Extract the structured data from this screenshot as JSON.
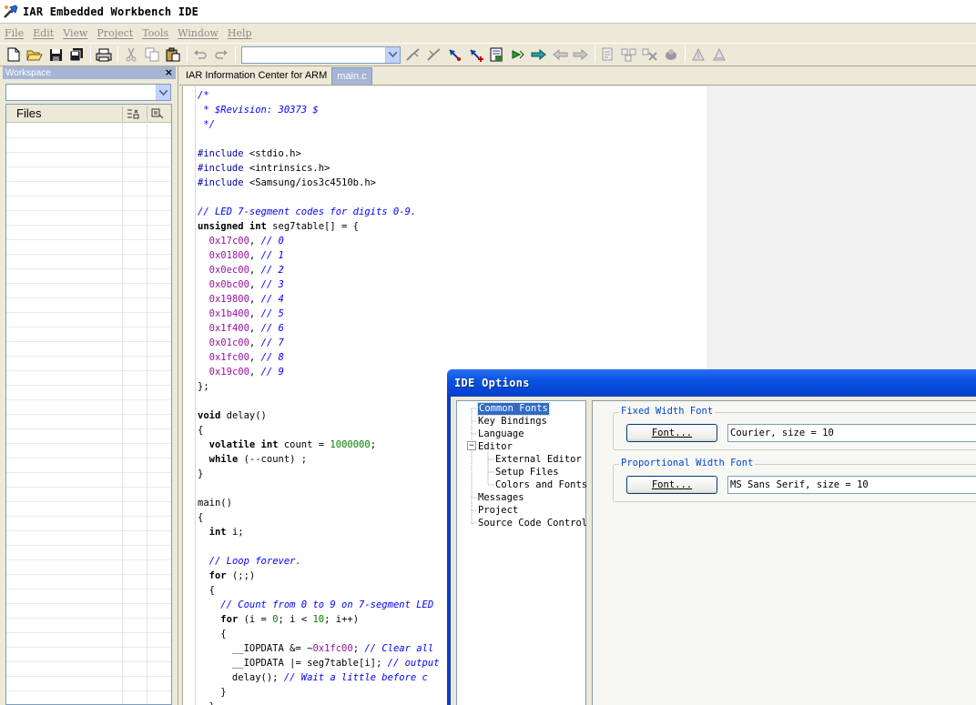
{
  "window": {
    "title": "IAR Embedded Workbench IDE"
  },
  "menu": [
    "File",
    "Edit",
    "View",
    "Project",
    "Tools",
    "Window",
    "Help"
  ],
  "toolbar": {
    "icons": [
      "new-file-icon",
      "open-icon",
      "save-icon",
      "save-all-icon",
      "print-icon",
      "cut-icon",
      "copy-icon",
      "paste-icon",
      "undo-icon",
      "redo-icon",
      "find-combo",
      "toggle-bookmark-icon",
      "goto-bookmark-icon",
      "toggle-breakpoint-icon",
      "edit-breakpoints-icon",
      "find-in-files-icon",
      "next-error-icon",
      "step-icon",
      "navigate-back-icon",
      "navigate-forward-icon",
      "compile-icon",
      "make-icon",
      "stop-build-icon",
      "debug-icon",
      "download-debug-icon",
      "debug-without-download-icon"
    ],
    "find_value": ""
  },
  "workspace": {
    "title": "Workspace",
    "close": "×",
    "config_value": "",
    "files_header": "Files"
  },
  "tabs": [
    {
      "label": "IAR Information Center for ARM",
      "active": false
    },
    {
      "label": "main.c",
      "active": true
    }
  ],
  "code": [
    [
      [
        "cm",
        "/*"
      ]
    ],
    [
      [
        "cm",
        " * $Revision: 30373 $"
      ]
    ],
    [
      [
        "cm",
        " */"
      ]
    ],
    [],
    [
      [
        "pp",
        "#include"
      ],
      [
        "",
        " <stdio.h>"
      ]
    ],
    [
      [
        "pp",
        "#include"
      ],
      [
        "",
        " <intrinsics.h>"
      ]
    ],
    [
      [
        "pp",
        "#include"
      ],
      [
        "",
        " <Samsung/ios3c4510b.h>"
      ]
    ],
    [],
    [
      [
        "cm",
        "// LED 7-segment codes for digits 0-9."
      ]
    ],
    [
      [
        "kw",
        "unsigned int"
      ],
      [
        "",
        " seg7table[] = {"
      ]
    ],
    [
      [
        "",
        "  "
      ],
      [
        "num",
        "0x17c00"
      ],
      [
        "",
        ", "
      ],
      [
        "cm",
        "// 0"
      ]
    ],
    [
      [
        "",
        "  "
      ],
      [
        "num",
        "0x01800"
      ],
      [
        "",
        ", "
      ],
      [
        "cm",
        "// 1"
      ]
    ],
    [
      [
        "",
        "  "
      ],
      [
        "num",
        "0x0ec00"
      ],
      [
        "",
        ", "
      ],
      [
        "cm",
        "// 2"
      ]
    ],
    [
      [
        "",
        "  "
      ],
      [
        "num",
        "0x0bc00"
      ],
      [
        "",
        ", "
      ],
      [
        "cm",
        "// 3"
      ]
    ],
    [
      [
        "",
        "  "
      ],
      [
        "num",
        "0x19800"
      ],
      [
        "",
        ", "
      ],
      [
        "cm",
        "// 4"
      ]
    ],
    [
      [
        "",
        "  "
      ],
      [
        "num",
        "0x1b400"
      ],
      [
        "",
        ", "
      ],
      [
        "cm",
        "// 5"
      ]
    ],
    [
      [
        "",
        "  "
      ],
      [
        "num",
        "0x1f400"
      ],
      [
        "",
        ", "
      ],
      [
        "cm",
        "// 6"
      ]
    ],
    [
      [
        "",
        "  "
      ],
      [
        "num",
        "0x01c00"
      ],
      [
        "",
        ", "
      ],
      [
        "cm",
        "// 7"
      ]
    ],
    [
      [
        "",
        "  "
      ],
      [
        "num",
        "0x1fc00"
      ],
      [
        "",
        ", "
      ],
      [
        "cm",
        "// 8"
      ]
    ],
    [
      [
        "",
        "  "
      ],
      [
        "num",
        "0x19c00"
      ],
      [
        "",
        ", "
      ],
      [
        "cm",
        "// 9"
      ]
    ],
    [
      [
        "",
        "};"
      ]
    ],
    [],
    [
      [
        "kw",
        "void"
      ],
      [
        "",
        " delay()"
      ]
    ],
    [
      [
        "",
        "{"
      ]
    ],
    [
      [
        "",
        "  "
      ],
      [
        "kw",
        "volatile int"
      ],
      [
        "",
        " count = "
      ],
      [
        "dec",
        "1000000"
      ],
      [
        "",
        ";"
      ]
    ],
    [
      [
        "",
        "  "
      ],
      [
        "kw",
        "while"
      ],
      [
        "",
        " (--count) ;"
      ]
    ],
    [
      [
        "",
        "}"
      ]
    ],
    [],
    [
      [
        "",
        "main()"
      ]
    ],
    [
      [
        "",
        "{"
      ]
    ],
    [
      [
        "",
        "  "
      ],
      [
        "kw",
        "int"
      ],
      [
        "",
        " i;"
      ]
    ],
    [],
    [
      [
        "",
        "  "
      ],
      [
        "cm",
        "// Loop forever."
      ]
    ],
    [
      [
        "",
        "  "
      ],
      [
        "kw",
        "for"
      ],
      [
        "",
        " (;;)"
      ]
    ],
    [
      [
        "",
        "  {"
      ]
    ],
    [
      [
        "",
        "    "
      ],
      [
        "cm",
        "// Count from 0 to 9 on 7-segment LED"
      ]
    ],
    [
      [
        "",
        "    "
      ],
      [
        "kw",
        "for"
      ],
      [
        "",
        " (i = "
      ],
      [
        "dec",
        "0"
      ],
      [
        "",
        "; i < "
      ],
      [
        "dec",
        "10"
      ],
      [
        "",
        "; i++)"
      ]
    ],
    [
      [
        "",
        "    {"
      ]
    ],
    [
      [
        "",
        "      __IOPDATA &= ~"
      ],
      [
        "num",
        "0x1fc00"
      ],
      [
        "",
        "; "
      ],
      [
        "cm",
        "// Clear all"
      ]
    ],
    [
      [
        "",
        "      __IOPDATA |= seg7table[i]; "
      ],
      [
        "cm",
        "// output"
      ]
    ],
    [
      [
        "",
        "      delay(); "
      ],
      [
        "cm",
        "// Wait a little before c"
      ]
    ],
    [
      [
        "",
        "    }"
      ]
    ],
    [
      [
        "",
        "  }"
      ]
    ]
  ],
  "dialog": {
    "title": "IDE Options",
    "tree": [
      {
        "label": "Common Fonts",
        "level": 0,
        "selected": true
      },
      {
        "label": "Key Bindings",
        "level": 0,
        "selected": false
      },
      {
        "label": "Language",
        "level": 0,
        "selected": false
      },
      {
        "label": "Editor",
        "level": 0,
        "selected": false,
        "expander": "−"
      },
      {
        "label": "External Editor",
        "level": 1,
        "selected": false
      },
      {
        "label": "Setup Files",
        "level": 1,
        "selected": false
      },
      {
        "label": "Colors and Fonts",
        "level": 1,
        "selected": false
      },
      {
        "label": "Messages",
        "level": 0,
        "selected": false
      },
      {
        "label": "Project",
        "level": 0,
        "selected": false
      },
      {
        "label": "Source Code Control",
        "level": 0,
        "selected": false
      }
    ],
    "fixed_group": {
      "legend": "Fixed Width Font",
      "button": "Font...",
      "value": "Courier, size = 10"
    },
    "proportional_group": {
      "legend": "Proportional Width Font",
      "button": "Font...",
      "value": "MS Sans Serif, size = 10"
    }
  },
  "colors": {
    "keyword": "#000000",
    "preprocessor": "#0000aa",
    "comment": "#0000ff",
    "hex_number": "#9b10a0",
    "decimal_number": "#008000",
    "dialog_title": "#0a54e3",
    "selection": "#316ac5"
  }
}
